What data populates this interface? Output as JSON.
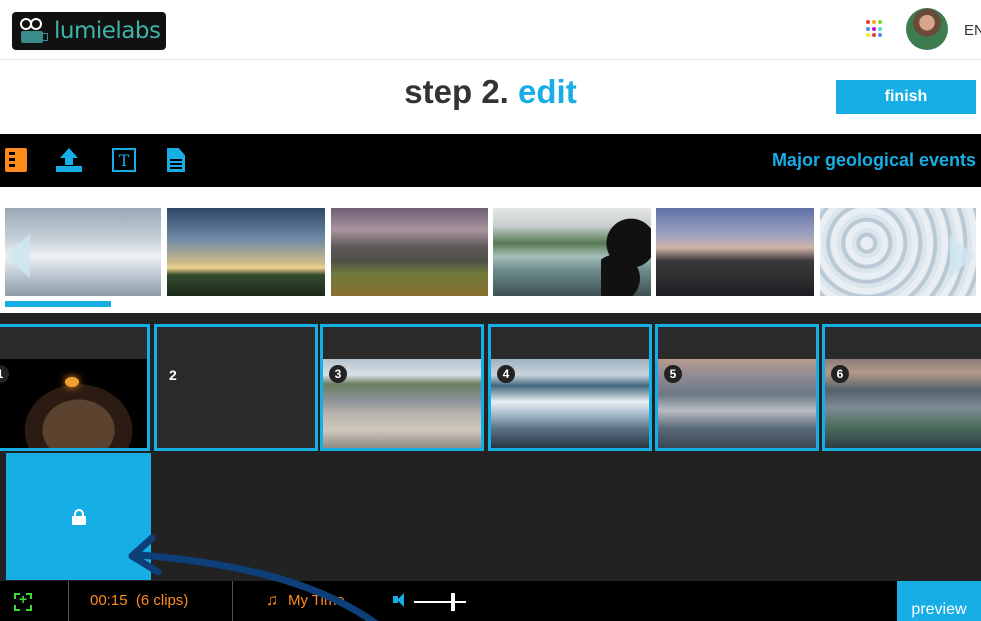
{
  "header": {
    "logo_text": "lumielabs",
    "apps_colors": [
      "#e63a3a",
      "#f5a623",
      "#7ed321",
      "#4a90e2",
      "#bd10e0",
      "#50e3c2",
      "#f8e71c",
      "#e63a3a",
      "#4a90e2"
    ],
    "language": "EN"
  },
  "step": {
    "prefix": "step 2.",
    "name": "edit",
    "finish_label": "finish"
  },
  "toolbar": {
    "tools": [
      "film-icon",
      "upload-icon",
      "text-icon",
      "document-icon"
    ],
    "text_tool_glyph": "T",
    "film_glyph": "b:",
    "project_title": "Major geological events"
  },
  "media_strip": {
    "thumbnails": [
      "clouds",
      "sunset",
      "mountain",
      "coast",
      "peaks",
      "ice"
    ]
  },
  "timeline": {
    "clips": [
      {
        "number": "1",
        "scene": "volcano"
      },
      {
        "number": "2",
        "scene": "empty"
      },
      {
        "number": "3",
        "scene": "damaged houses"
      },
      {
        "number": "4",
        "scene": "wave"
      },
      {
        "number": "5",
        "scene": "storm sea"
      },
      {
        "number": "6",
        "scene": "flood"
      }
    ],
    "locked": true
  },
  "bottom_bar": {
    "duration": "00:15",
    "clip_count_text": "(6 clips)",
    "music_label": "My Time",
    "volume": 0.75,
    "preview_label": "preview"
  },
  "colors": {
    "accent": "#16aee5",
    "orange": "#ff8c1a",
    "green": "#3adb3a"
  }
}
